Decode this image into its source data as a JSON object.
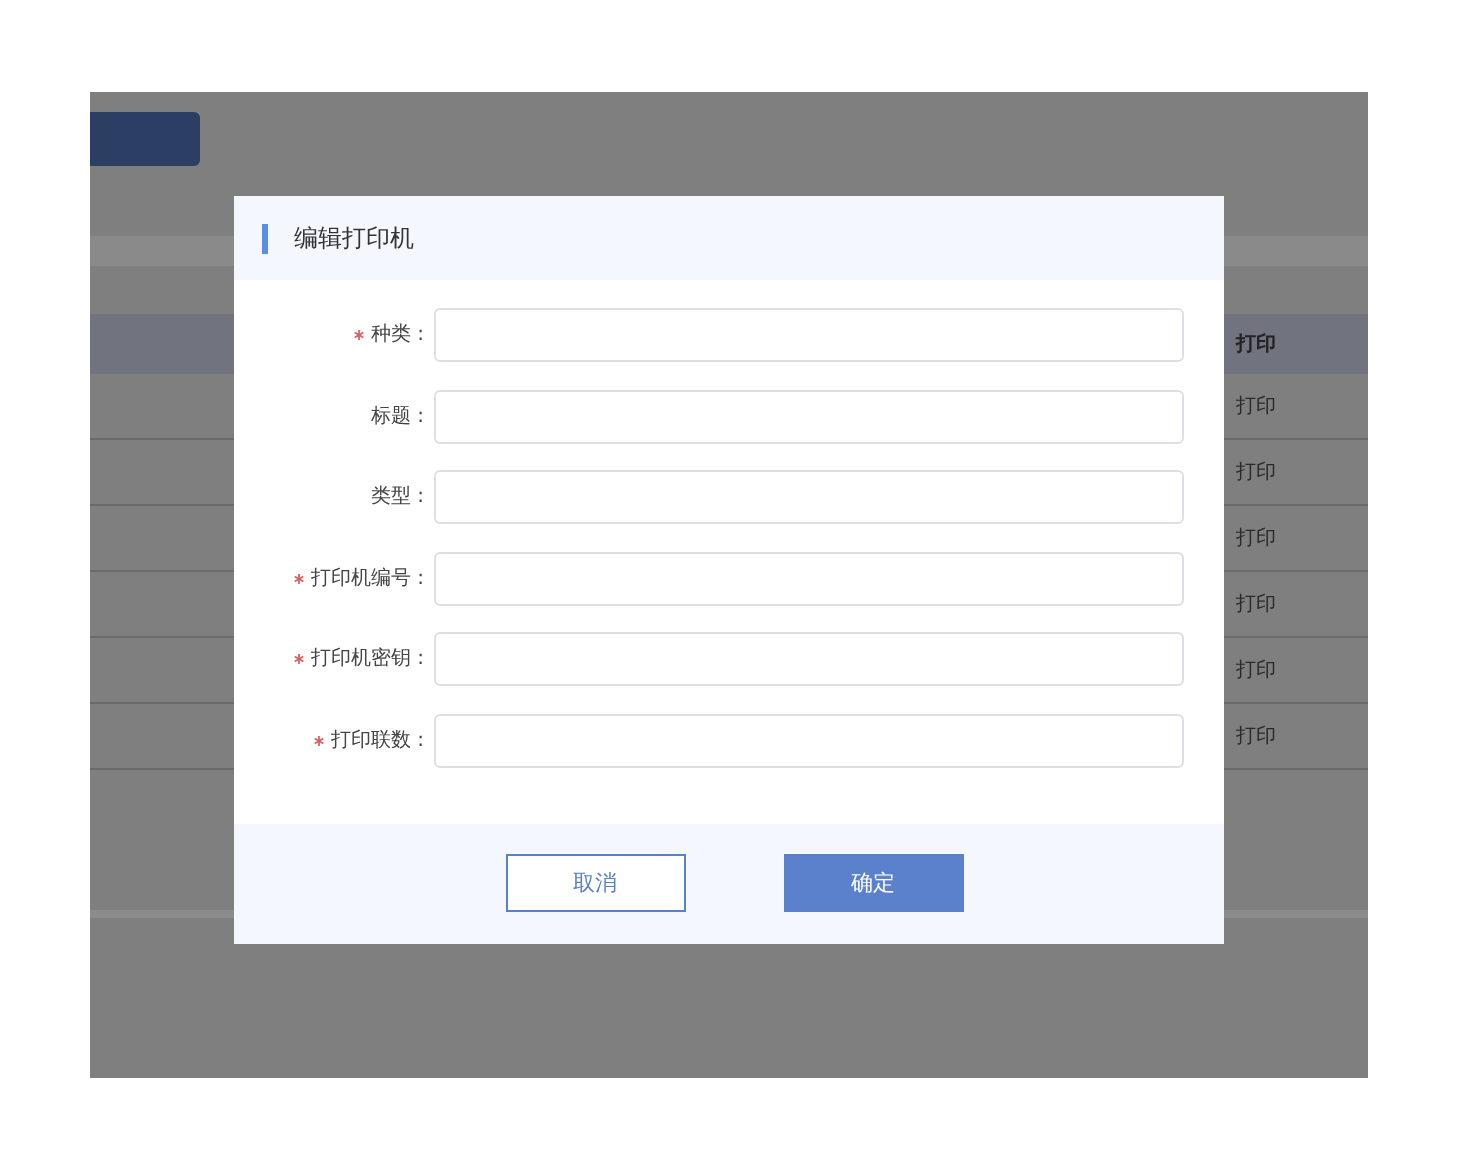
{
  "background": {
    "table": {
      "column_header": "打印",
      "cells": [
        "打印",
        "打印",
        "打印",
        "打印",
        "打印",
        "打印"
      ]
    }
  },
  "dialog": {
    "title": "编辑打印机",
    "fields": [
      {
        "label": "种类 :",
        "required": true
      },
      {
        "label": "标题 :",
        "required": false
      },
      {
        "label": "类型 :",
        "required": false
      },
      {
        "label": "打印机编号 :",
        "required": true
      },
      {
        "label": "打印机密钥 :",
        "required": true
      },
      {
        "label": "打印联数 :",
        "required": true
      }
    ],
    "buttons": [
      {
        "label": "取消",
        "kind": "secondary"
      },
      {
        "label": "确定",
        "kind": "primary"
      }
    ]
  }
}
